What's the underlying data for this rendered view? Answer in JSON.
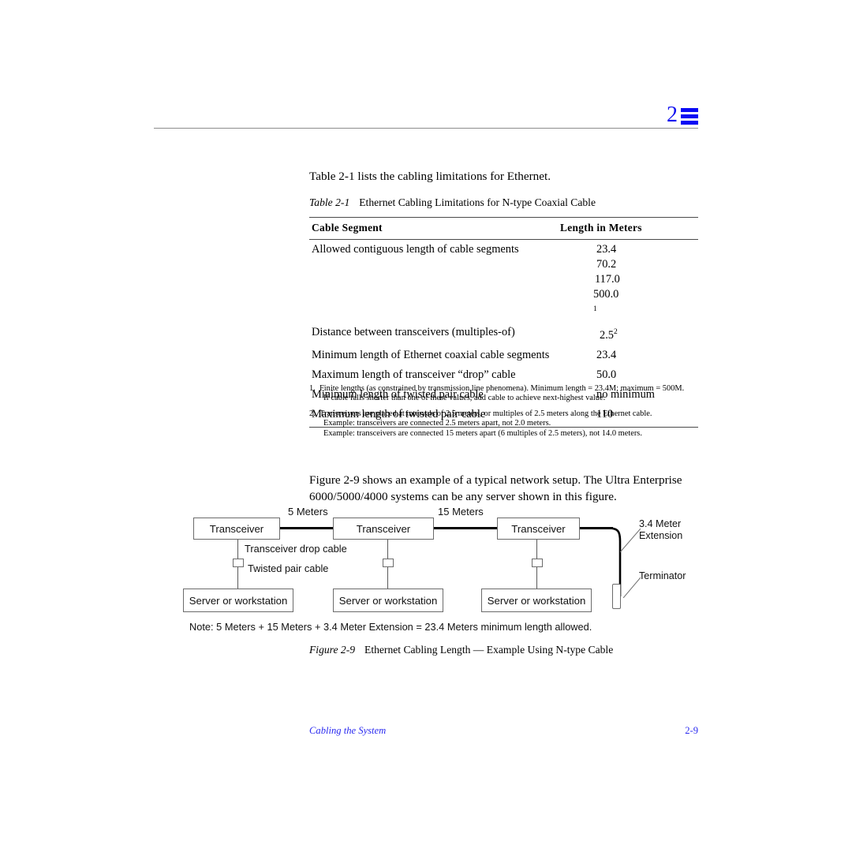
{
  "header": {
    "chapter_number": "2",
    "icon": "stacked-bars-icon",
    "accent_color": "#0a0af5"
  },
  "intro": {
    "text": "Table 2-1 lists the cabling limitations for Ethernet."
  },
  "table_caption": {
    "label": "Table 2-1",
    "title": "Ethernet Cabling Limitations for N-type Coaxial Cable"
  },
  "table": {
    "columns": [
      "Cable Segment",
      "Length in Meters"
    ],
    "rows": [
      {
        "segment": "Allowed contiguous length of cable segments",
        "values": [
          "23.4",
          "70.2",
          "117.0",
          "500.0"
        ],
        "footnote_marker": "1"
      },
      {
        "segment": "Distance between transceivers (multiples-of)",
        "values": [
          "2.5"
        ],
        "footnote_marker": "2"
      },
      {
        "segment": "Minimum length of Ethernet coaxial cable segments",
        "values": [
          "23.4"
        ],
        "footnote_marker": ""
      },
      {
        "segment": "Maximum length of transceiver “drop” cable",
        "values": [
          "50.0"
        ],
        "footnote_marker": ""
      },
      {
        "segment": "Minimum length of twisted pair cable",
        "values": [
          "no minimum"
        ],
        "footnote_marker": ""
      },
      {
        "segment": "Maximum length of twisted pair cable",
        "values": [
          "110"
        ],
        "footnote_marker": ""
      }
    ]
  },
  "footnotes": [
    {
      "number": "1.",
      "lines": [
        "Finite lengths (as constrained by transmission line phenomena). Minimum length = 23.4M; maximum = 500M.",
        "If cable falls shorter than one of these values, add cable to achieve next-highest value."
      ]
    },
    {
      "number": "2.",
      "lines": [
        "Transceivers are placed at intervals of 2.5 meters, or multiples of 2.5 meters along the Ethernet cable.",
        "Example: transceivers are connected 2.5 meters apart, not 2.0 meters.",
        "Example: transceivers are connected 15 meters apart (6 multiples of 2.5 meters), not 14.0 meters."
      ]
    }
  ],
  "figure_paragraph": {
    "line1": "Figure 2-9 shows an example of a typical network setup. The Ultra Enterprise",
    "line2": "6000/5000/4000 systems can be any server shown in this figure."
  },
  "diagram": {
    "transceivers": [
      "Transceiver",
      "Transceiver",
      "Transceiver"
    ],
    "servers": [
      "Server or workstation",
      "Server or workstation",
      "Server or workstation"
    ],
    "segment_labels": [
      "5 Meters",
      "15 Meters"
    ],
    "inline_labels": {
      "drop_cable": "Transceiver drop cable",
      "twisted_pair": "Twisted pair cable"
    },
    "callouts": {
      "extension_line1": "3.4 Meter",
      "extension_line2": "Extension",
      "terminator": "Terminator"
    }
  },
  "note": {
    "text": "Note: 5 Meters + 15 Meters + 3.4 Meter Extension = 23.4 Meters minimum length allowed."
  },
  "figure_caption": {
    "label": "Figure 2-9",
    "title": "Ethernet Cabling Length — Example Using N-type Cable"
  },
  "footer": {
    "section": "Cabling the System",
    "page_number": "2-9",
    "color": "#2a2af0"
  }
}
